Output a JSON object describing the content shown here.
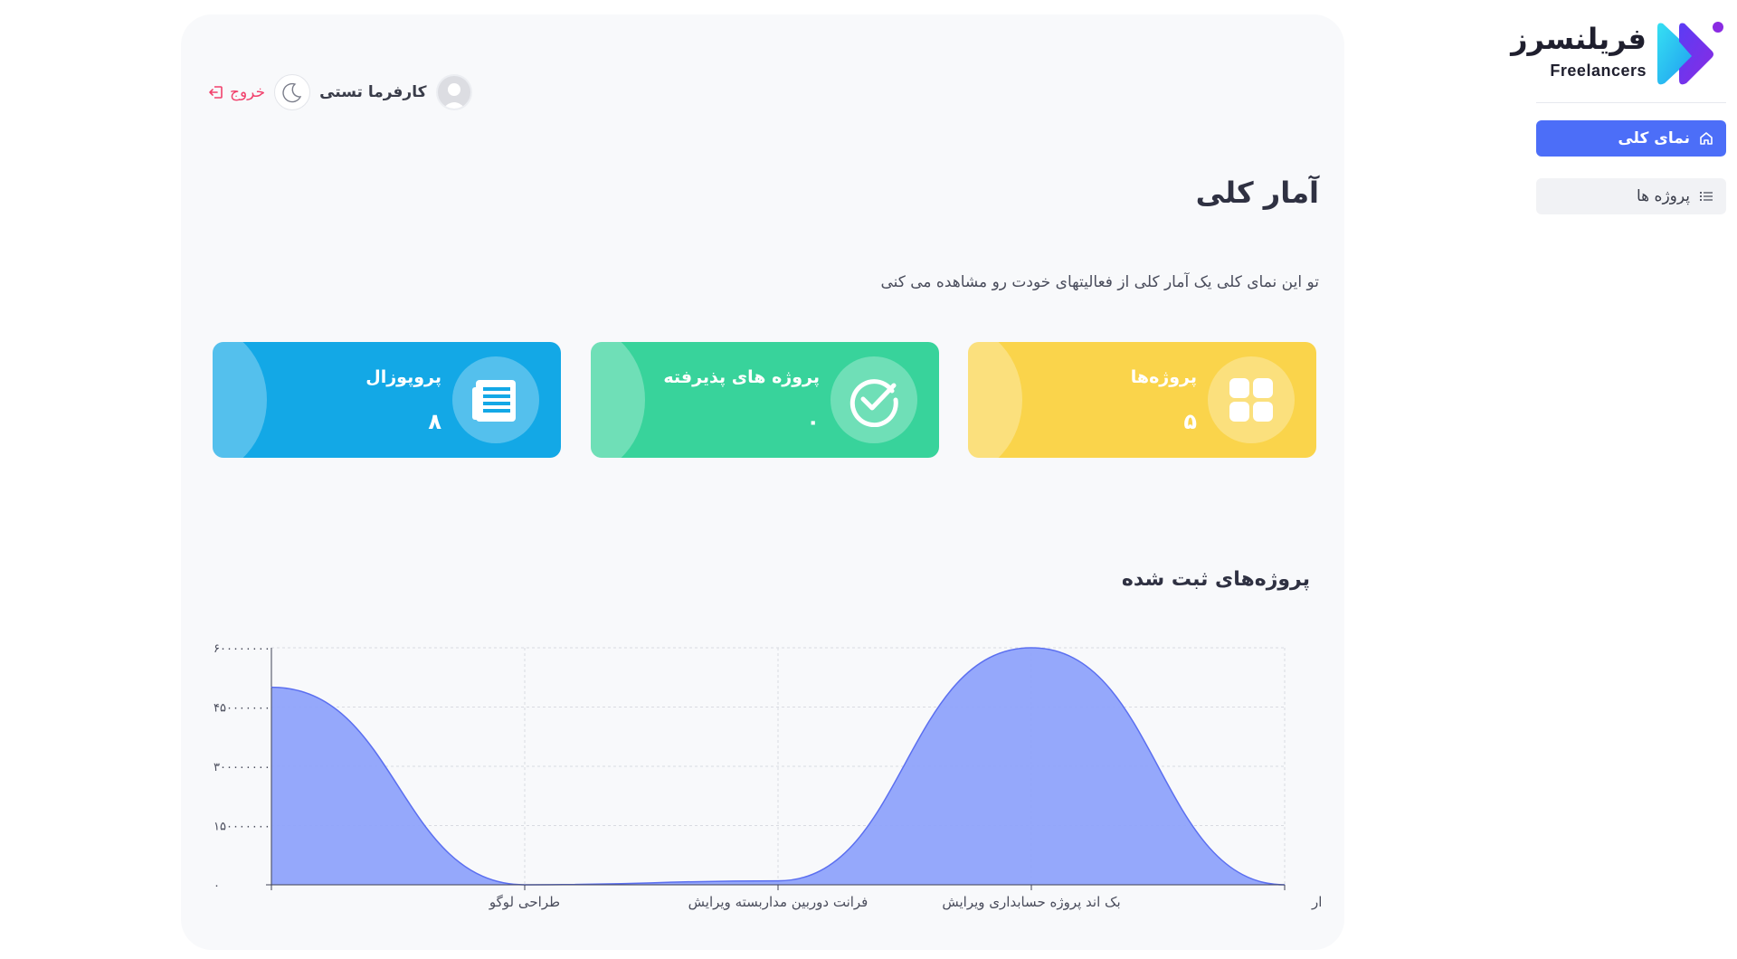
{
  "sidebar": {
    "brand_fa": "فریلنسرز",
    "brand_en": "Freelancers",
    "items": [
      {
        "label": "نمای کلی",
        "icon": "home-icon",
        "active": true
      },
      {
        "label": "پروژه ها",
        "icon": "list-icon",
        "active": false
      }
    ],
    "colors": {
      "active_bg": "#4c6ef8",
      "item_bg": "#f1f2f5"
    }
  },
  "header": {
    "user_name": "کارفرما تستی",
    "logout_label": "خروج",
    "theme_toggle_icon": "moon-icon",
    "avatar_icon": "user-avatar-icon"
  },
  "page": {
    "title": "آمار کلی",
    "description": "تو این نمای کلی یک آمار کلی از فعالیتهای خودت رو مشاهده می کنی"
  },
  "cards": [
    {
      "label": "پروژه‌ها",
      "value": "۵",
      "icon": "grid-icon",
      "color": "#fad44b"
    },
    {
      "label": "پروژه های پذیرفته",
      "value": "۰",
      "icon": "check-circle-icon",
      "color": "#38d39b"
    },
    {
      "label": "پروپوزال",
      "value": "۸",
      "icon": "document-icon",
      "color": "#13a8e6"
    }
  ],
  "chart_section": {
    "title": "پروژه‌های ثبت شده"
  },
  "chart_data": {
    "type": "area",
    "title": "پروژه‌های ثبت شده",
    "categories": [
      "",
      "طراحی لوگو",
      "فرانت دوربین مداربسته ویرایش",
      "بک اند پروژه حسابداری ویرایش",
      "تست نرم افزار"
    ],
    "series": [
      {
        "values": [
          50000000,
          0,
          1000000,
          60000000,
          0
        ]
      }
    ],
    "ylim": [
      0,
      60000000
    ],
    "yticks": [
      0,
      15000000,
      30000000,
      45000000,
      60000000
    ],
    "ytick_labels": [
      "۰",
      "۱۵۰۰۰۰۰۰۰",
      "۳۰۰۰۰۰۰۰۰",
      "۴۵۰۰۰۰۰۰۰",
      "۶۰۰۰۰۰۰۰۰"
    ],
    "grid": true,
    "fill_color": "#8fa3fb",
    "stroke_color": "#5b6ff0"
  }
}
